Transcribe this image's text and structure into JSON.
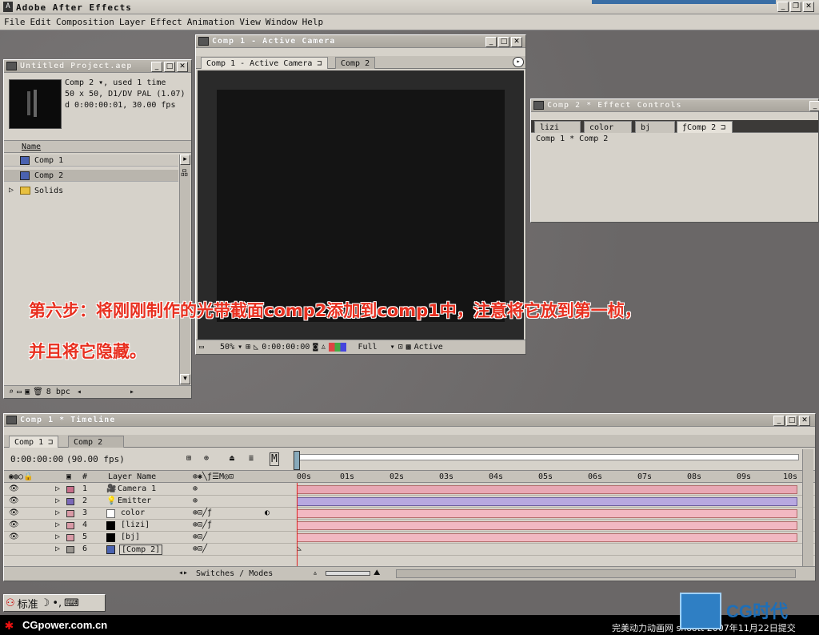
{
  "app": {
    "title": "Adobe After Effects"
  },
  "menu": [
    "File",
    "Edit",
    "Composition",
    "Layer",
    "Effect",
    "Animation",
    "View",
    "Window",
    "Help"
  ],
  "project": {
    "title": "Untitled Project.aep",
    "info_line1": "Comp 2 ▾, used 1 time",
    "info_line2": "50 x 50, D1/DV PAL (1.07)",
    "info_line3": "d 0:00:00:01, 30.00 fps",
    "col_name": "Name",
    "items": [
      "Comp 1",
      "Comp 2",
      "Solids"
    ],
    "bpc": "8 bpc"
  },
  "comp_viewer": {
    "title": "Comp 1 - Active Camera",
    "tab1": "Comp 1 - Active Camera",
    "tab2": "Comp 2",
    "zoom": "50%",
    "timecode": "0:00:00:00",
    "resolution": "Full",
    "camera": "Active"
  },
  "effects": {
    "title": "Comp 2 * Effect Controls",
    "tabs": [
      "lizi",
      "color",
      "bj",
      "Comp 2"
    ],
    "path": "Comp 1 * Comp 2"
  },
  "timeline": {
    "title": "Comp 1 * Timeline",
    "tabs": [
      "Comp 1",
      "Comp 2"
    ],
    "timecode": "0:00:00:00",
    "fps": "(90.00 fps)",
    "col_hash": "#",
    "col_layer": "Layer Name",
    "switches": "Switches / Modes",
    "ruler": [
      "00s",
      "01s",
      "02s",
      "03s",
      "04s",
      "05s",
      "06s",
      "07s",
      "08s",
      "09s",
      "10s"
    ],
    "layers": [
      {
        "num": "1",
        "name": "Camera 1",
        "color": "#c86e8a",
        "bar": "#e8a8b4"
      },
      {
        "num": "2",
        "name": "Emitter",
        "color": "#7b68b8",
        "bar": "#b8a8e0"
      },
      {
        "num": "3",
        "name": "color",
        "color": "#d99aa6",
        "bar": "#f2b8c2"
      },
      {
        "num": "4",
        "name": "[lizi]",
        "color": "#d99aa6",
        "bar": "#f2b8c2"
      },
      {
        "num": "5",
        "name": "[bj]",
        "color": "#d99aa6",
        "bar": "#f2b8c2"
      },
      {
        "num": "6",
        "name": "[Comp 2]",
        "color": "#9a9690",
        "bar": ""
      }
    ]
  },
  "caption": {
    "line1": "第六步：将刚刚制作的光带截面comp2添加到comp1中，注意将它放到第一桢，",
    "line2": "并且将它隐藏。"
  },
  "taskbar": {
    "ime": "标准"
  },
  "footer": {
    "site": "CGpower.com.cn",
    "submit": "完美动力动画网 shoott 2007年11月22日提交",
    "logo": "CG时代"
  }
}
